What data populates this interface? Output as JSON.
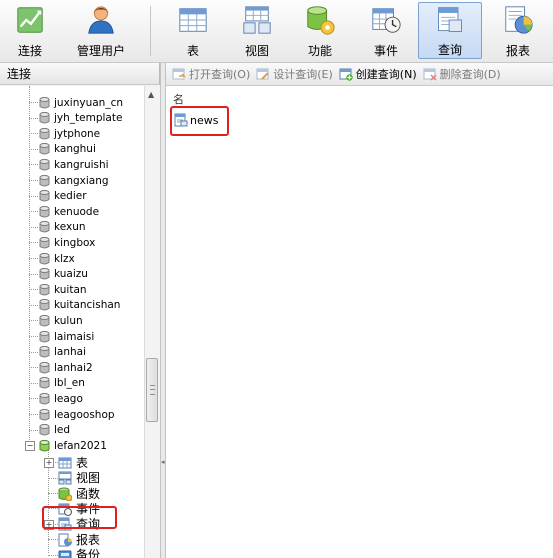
{
  "toolbar": {
    "buttons": [
      {
        "label": "连接",
        "icon": "connection-icon"
      },
      {
        "label": "管理用户",
        "icon": "user-icon"
      },
      {
        "label": "表",
        "icon": "table-icon"
      },
      {
        "label": "视图",
        "icon": "view-icon"
      },
      {
        "label": "功能",
        "icon": "function-icon"
      },
      {
        "label": "事件",
        "icon": "event-icon"
      },
      {
        "label": "查询",
        "icon": "query-icon",
        "active": true
      },
      {
        "label": "报表",
        "icon": "report-icon"
      }
    ]
  },
  "left_panel": {
    "header": "连接",
    "databases": [
      "juxinyuan_cn",
      "jyh_template",
      "jytphone",
      "kanghui",
      "kangruishi",
      "kangxiang",
      "kedier",
      "kenuode",
      "kexun",
      "kingbox",
      "klzx",
      "kuaizu",
      "kuitan",
      "kuitancishan",
      "kulun",
      "laimaisi",
      "lanhai",
      "lanhai2",
      "lbl_en",
      "leago",
      "leagooshop",
      "led"
    ],
    "open_database": {
      "name": "lefan2021",
      "children": [
        {
          "label": "表",
          "icon": "table-icon",
          "expandable": true
        },
        {
          "label": "视图",
          "icon": "view-icon",
          "expandable": false
        },
        {
          "label": "函数",
          "icon": "function-icon",
          "expandable": false
        },
        {
          "label": "事件",
          "icon": "event-icon",
          "expandable": false
        },
        {
          "label": "查询",
          "icon": "query-icon",
          "expandable": true,
          "highlighted": true
        },
        {
          "label": "报表",
          "icon": "report-icon",
          "expandable": false
        },
        {
          "label": "备份",
          "icon": "backup-icon",
          "expandable": false
        }
      ]
    }
  },
  "right_panel": {
    "actions": [
      {
        "label": "打开查询(O)",
        "icon": "open-query-icon",
        "enabled": false
      },
      {
        "label": "设计查询(E)",
        "icon": "design-query-icon",
        "enabled": false
      },
      {
        "label": "创建查询(N)",
        "icon": "create-query-icon",
        "enabled": true
      },
      {
        "label": "删除查询(D)",
        "icon": "delete-query-icon",
        "enabled": false
      }
    ],
    "column_header": "名",
    "items": [
      {
        "name": "news",
        "icon": "query-icon",
        "highlighted": true
      }
    ]
  },
  "colors": {
    "highlight": "#e0201f",
    "active_tab": "#c6d9f3",
    "db_icon": "#9c9c9c",
    "open_db_icon": "#6fbf3a"
  }
}
